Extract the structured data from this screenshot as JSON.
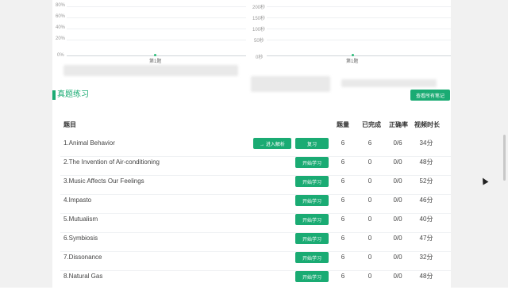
{
  "charts": {
    "left": {
      "yticks": [
        "80%",
        "60%",
        "40%",
        "20%",
        "0%"
      ],
      "category": "第1题"
    },
    "right": {
      "yticks": [
        "200秒",
        "150秒",
        "100秒",
        "50秒",
        "0秒"
      ],
      "category": "第1题"
    }
  },
  "section": {
    "title": "真题练习",
    "notes_button": "查看所有笔记"
  },
  "table": {
    "headers": {
      "title": "题目",
      "count": "题量",
      "done": "已完成",
      "accuracy": "正确率",
      "duration": "视频时长"
    },
    "rows": [
      {
        "title": "1.Animal Behavior",
        "analysis_button": "→ 进入解析",
        "action": "复习",
        "count": "6",
        "done": "6",
        "accuracy": "0/6",
        "duration": "34分"
      },
      {
        "title": "2.The Invention of Air-conditioning",
        "action": "开始学习",
        "count": "6",
        "done": "0",
        "accuracy": "0/0",
        "duration": "48分"
      },
      {
        "title": "3.Music Affects Our Feelings",
        "action": "开始学习",
        "count": "6",
        "done": "0",
        "accuracy": "0/0",
        "duration": "52分"
      },
      {
        "title": "4.Impasto",
        "action": "开始学习",
        "count": "6",
        "done": "0",
        "accuracy": "0/0",
        "duration": "46分"
      },
      {
        "title": "5.Mutualism",
        "action": "开始学习",
        "count": "6",
        "done": "0",
        "accuracy": "0/0",
        "duration": "40分"
      },
      {
        "title": "6.Symbiosis",
        "action": "开始学习",
        "count": "6",
        "done": "0",
        "accuracy": "0/0",
        "duration": "47分"
      },
      {
        "title": "7.Dissonance",
        "action": "开始学习",
        "count": "6",
        "done": "0",
        "accuracy": "0/0",
        "duration": "32分"
      },
      {
        "title": "8.Natural Gas",
        "action": "开始学习",
        "count": "6",
        "done": "0",
        "accuracy": "0/0",
        "duration": "48分"
      }
    ]
  },
  "colors": {
    "accent": "#1aab73",
    "background": "#ffffff"
  }
}
